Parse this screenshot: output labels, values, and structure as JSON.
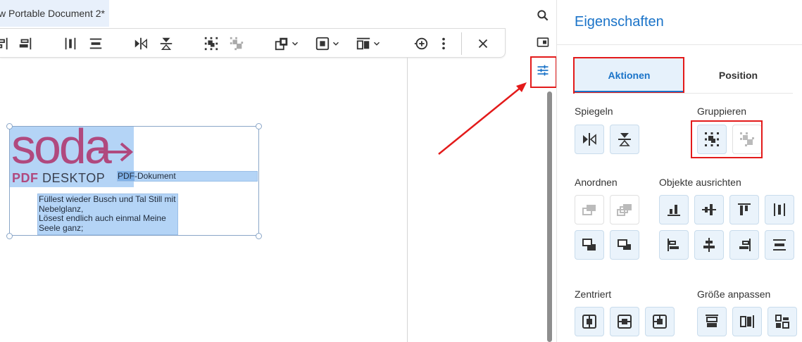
{
  "document": {
    "tab_title": "w Portable Document 2*",
    "logo_text": "soda",
    "logo_sub_bold": "PDF",
    "logo_sub_rest": " DESKTOP",
    "pdf_label_hl": "PDF",
    "pdf_label_rest": "-Dokument",
    "poem_lines": [
      "Füllest wieder Busch und Tal Still mit",
      "Nebelglanz,",
      "Lösest endlich auch einmal Meine",
      "Seele ganz;"
    ]
  },
  "toolbar": {
    "icons": [
      "align-left-partial-icon",
      "align-right-edge-icon",
      "align-center-vertical-icon",
      "align-horizontal-center-icon",
      "flip-horizontal-icon",
      "flip-vertical-icon",
      "group-icon",
      "ungroup-icon",
      "arrange-icon",
      "center-icon",
      "size-icon",
      "add-circle-icon",
      "more-vert-icon",
      "close-icon"
    ]
  },
  "rail": {
    "icons": [
      "search-icon",
      "panel-icon",
      "properties-tune-icon"
    ]
  },
  "panel": {
    "title": "Eigenschaften",
    "tabs": [
      {
        "label": "Aktionen",
        "active": true
      },
      {
        "label": "Position",
        "active": false
      }
    ],
    "sections": {
      "spiegeln": "Spiegeln",
      "gruppieren": "Gruppieren",
      "anordnen": "Anordnen",
      "ausrichten": "Objekte ausrichten",
      "zentriert": "Zentriert",
      "groesse": "Größe anpassen"
    }
  },
  "colors": {
    "accent": "#1a73c8",
    "highlight_outline": "#e31a1a",
    "selection": "#b4d4f6",
    "logo_magenta": "#b0497e"
  }
}
